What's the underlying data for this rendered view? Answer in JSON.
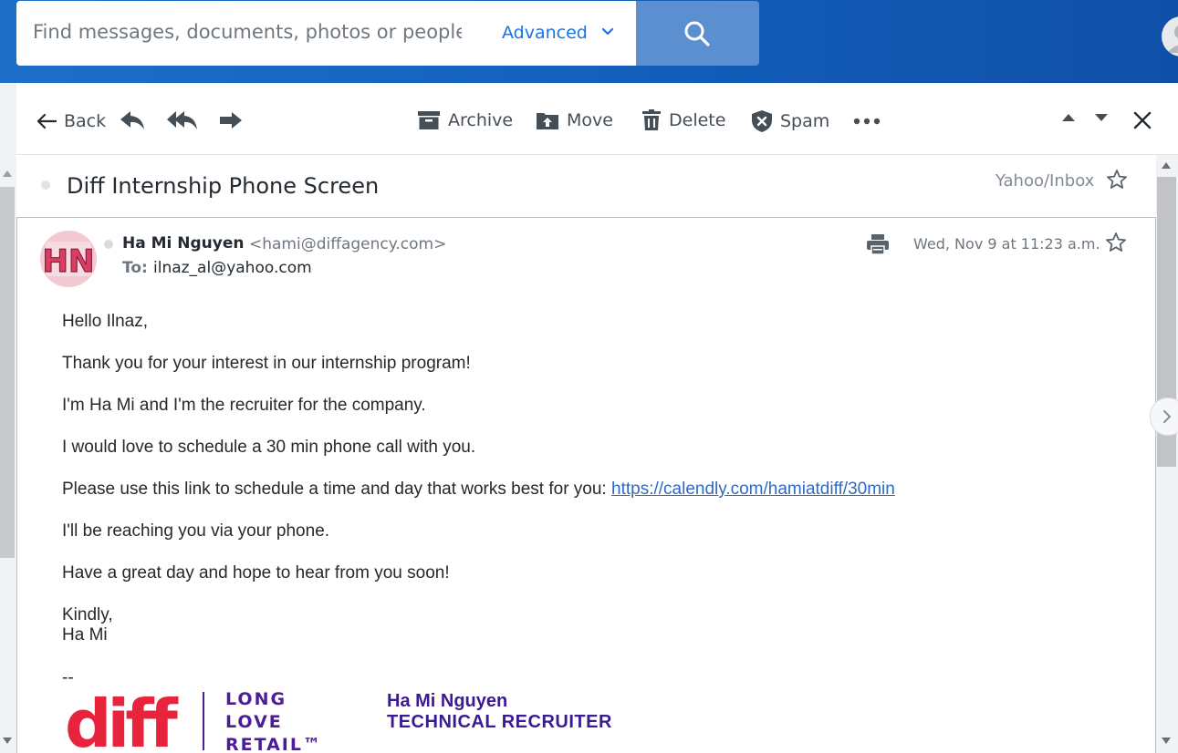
{
  "search": {
    "placeholder": "Find messages, documents, photos or people",
    "advanced_label": "Advanced"
  },
  "toolbar": {
    "back_label": "Back",
    "archive_label": "Archive",
    "move_label": "Move",
    "delete_label": "Delete",
    "spam_label": "Spam"
  },
  "message": {
    "subject": "Diff Internship Phone Screen",
    "folder": "Yahoo/Inbox",
    "sender_name": "Ha Mi Nguyen",
    "sender_email": "<hami@diffagency.com>",
    "to_label": "To:",
    "to_value": "ilnaz_al@yahoo.com",
    "date": "Wed, Nov 9 at 11:23 a.m.",
    "body": {
      "greeting": "Hello Ilnaz,",
      "line1": "Thank you for your interest in our internship program!",
      "line2": "I'm Ha Mi and I'm the recruiter for the company.",
      "line3": "I would love to schedule a 30 min phone call with you.",
      "line4_prefix": "Please use this link to schedule a time and day that works best for you: ",
      "line4_link": "https://calendly.com/hamiatdiff/30min",
      "line5": "I'll be reaching you via your phone.",
      "line6": "Have a great day and hope to hear from you soon!",
      "closing": "Kindly,",
      "closing_name": "Ha Mi",
      "sig_sep": "--"
    },
    "signature": {
      "logo_text": "diff",
      "tagline_1": "LONG",
      "tagline_2": "LOVE",
      "tagline_3": "RETAIL™",
      "name": "Ha Mi Nguyen",
      "title": "TECHNICAL RECRUITER"
    }
  },
  "icons": [
    "search-icon",
    "chevron-down-icon",
    "back-arrow-icon",
    "reply-icon",
    "reply-all-icon",
    "forward-icon",
    "archive-icon",
    "move-icon",
    "delete-icon",
    "spam-icon",
    "more-icon",
    "previous-message-icon",
    "next-message-icon",
    "close-icon",
    "star-icon",
    "print-icon",
    "chevron-right-icon"
  ],
  "colors": {
    "header_blue": "#1462bd",
    "link": "#2f69c4",
    "signature_purple": "#4b1d96",
    "logo_red": "#e8243c"
  }
}
